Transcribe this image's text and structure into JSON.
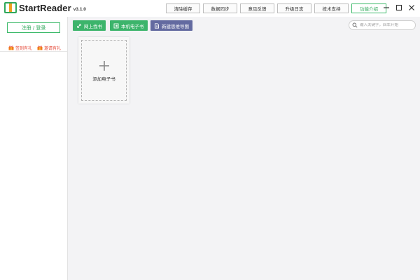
{
  "app": {
    "name": "StartReader",
    "version": "v3.1.0",
    "brand_color": "#3cb46b"
  },
  "topbar": {
    "buttons": [
      {
        "label": "清除缓存"
      },
      {
        "label": "数据同步"
      },
      {
        "label": "意见反馈"
      },
      {
        "label": "升级日志"
      },
      {
        "label": "技术支持"
      },
      {
        "label": "功能介绍"
      }
    ]
  },
  "sidebar": {
    "login_label": "注册 / 登录",
    "links": [
      {
        "label": "签到有礼",
        "icon": "gift-icon"
      },
      {
        "label": "邀请有礼",
        "icon": "gift-icon"
      }
    ]
  },
  "toolbar": {
    "find_online_label": "网上找书",
    "local_books_label": "本机电子书",
    "new_mindmap_label": "新建思维导图"
  },
  "search": {
    "placeholder": "输入关键字，回车开始"
  },
  "library": {
    "add_book_label": "添加电子书"
  }
}
